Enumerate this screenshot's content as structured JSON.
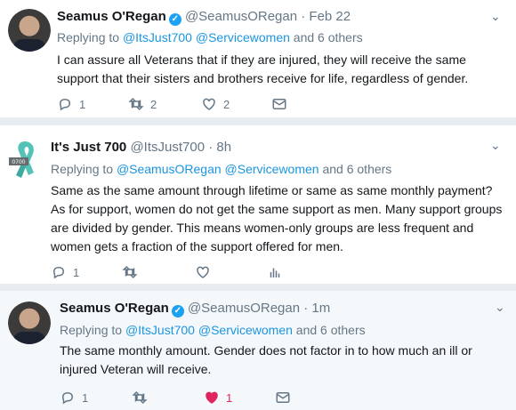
{
  "tweets": [
    {
      "name": "Seamus O'Regan",
      "handle": "@SeamusORegan · Feb 22",
      "reply_prefix": "Replying to",
      "reply_to_1": "@ItsJust700",
      "reply_to_2": "@Servicewomen",
      "reply_suffix": "and 6 others",
      "text": "I can assure all Veterans that if they are injured, they will receive the same support that their sisters and brothers receive for life, regardless of gender.",
      "reply_count": "1",
      "retweet_count": "2",
      "like_count": "2"
    },
    {
      "name": "It's Just 700",
      "handle": "@ItsJust700 · 8h",
      "avatar_label": "0700",
      "reply_prefix": "Replying to",
      "reply_to_1": "@SeamusORegan",
      "reply_to_2": "@Servicewomen",
      "reply_suffix": "and 6 others",
      "text": "Same as the same amount through lifetime or same as same monthly payment? As for support, women do not get the same support as men. Many support groups are divided by gender. This means women-only groups are less frequent and women gets a fraction of the support offered for men.",
      "reply_count": "1"
    },
    {
      "name": "Seamus O'Regan",
      "handle": "@SeamusORegan · 1m",
      "reply_prefix": "Replying to",
      "reply_to_1": "@ItsJust700",
      "reply_to_2": "@Servicewomen",
      "reply_suffix": "and 6 others",
      "text": "The same monthly amount. Gender does not factor in to how much an ill or injured Veteran will receive.",
      "reply_count": "1",
      "like_count": "1"
    }
  ],
  "colors": {
    "accent": "#1da1f2",
    "link": "#1b95e0",
    "muted": "#657786",
    "like": "#e0245e",
    "ribbon": "#55c2b8"
  },
  "icons": [
    "verified-badge-icon",
    "chevron-down-icon",
    "reply-icon",
    "retweet-icon",
    "heart-icon",
    "message-icon",
    "analytics-icon"
  ]
}
